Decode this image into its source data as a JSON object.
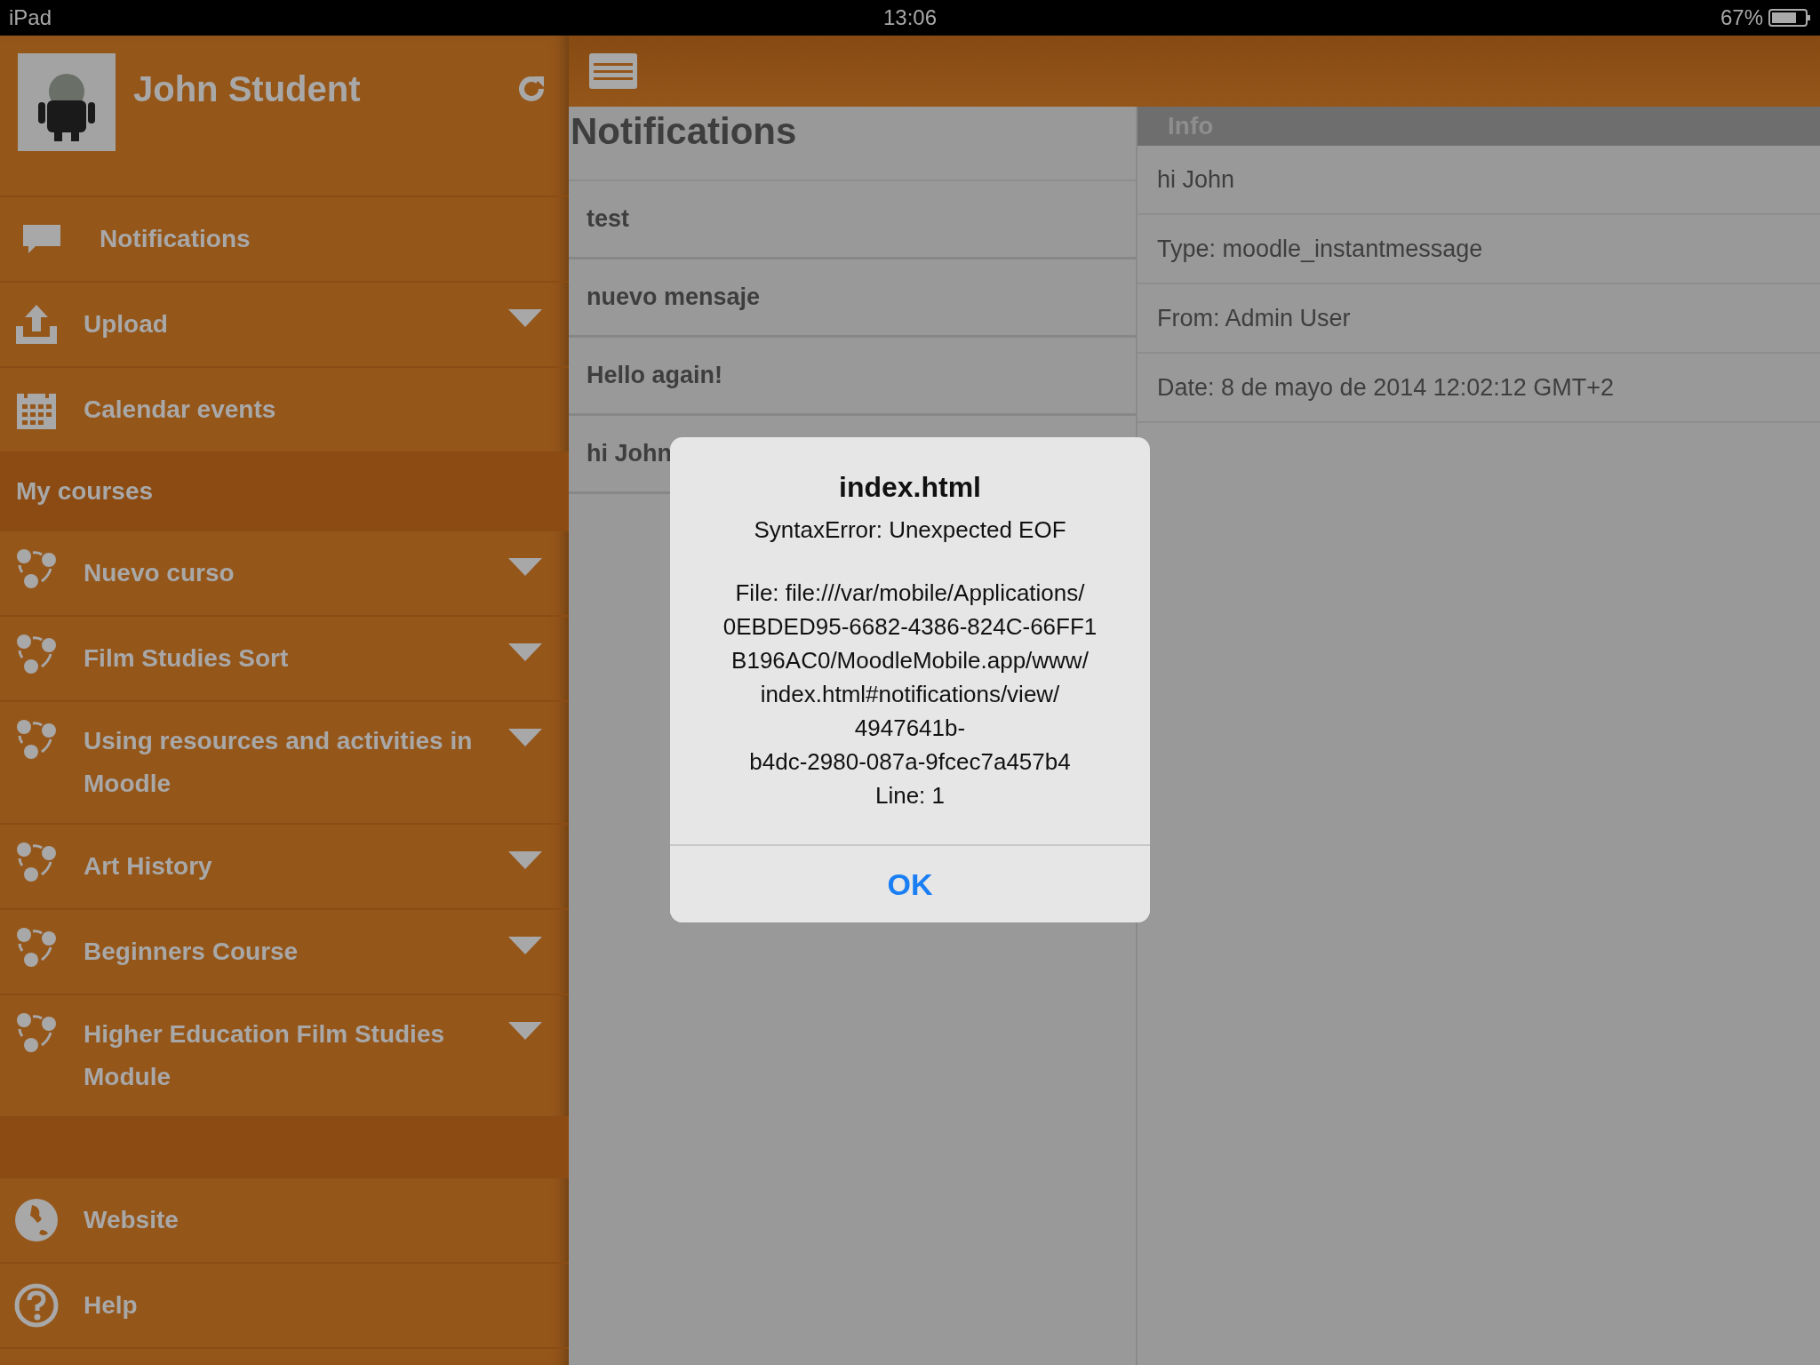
{
  "status_bar": {
    "device": "iPad",
    "time": "13:06",
    "battery": "67%"
  },
  "sidebar": {
    "user_name": "John Student",
    "items": [
      {
        "kind": "message",
        "label": "Notifications",
        "expandable": false
      },
      {
        "kind": "upload",
        "label": "Upload",
        "expandable": true
      },
      {
        "kind": "calendar",
        "label": "Calendar events",
        "expandable": false
      },
      {
        "kind": "section",
        "label": "My courses"
      },
      {
        "kind": "course",
        "label": "Nuevo curso",
        "expandable": true
      },
      {
        "kind": "course",
        "label": "Film Studies Sort",
        "expandable": true
      },
      {
        "kind": "course",
        "label": "Using resources and activities in Moodle",
        "expandable": true
      },
      {
        "kind": "course",
        "label": "Art History",
        "expandable": true
      },
      {
        "kind": "course",
        "label": "Beginners Course",
        "expandable": true
      },
      {
        "kind": "course",
        "label": "Higher Education Film Studies Module",
        "expandable": true
      },
      {
        "kind": "spacer"
      },
      {
        "kind": "website",
        "label": "Website",
        "expandable": false
      },
      {
        "kind": "help",
        "label": "Help",
        "expandable": false
      }
    ]
  },
  "notifications": {
    "title": "Notifications",
    "items": [
      {
        "label": "test"
      },
      {
        "label": "nuevo mensaje"
      },
      {
        "label": "Hello again!"
      },
      {
        "label": "hi John"
      }
    ]
  },
  "info": {
    "title": "Info",
    "rows": [
      "hi John",
      "Type: moodle_instantmessage",
      "From: Admin User",
      "Date: 8 de mayo de 2014 12:02:12 GMT+2"
    ]
  },
  "alert": {
    "title": "index.html",
    "message": "SyntaxError: Unexpected EOF",
    "details": [
      "File: file:///var/mobile/Applications/",
      "0EBDED95-6682-4386-824C-66FF1",
      "B196AC0/MoodleMobile.app/www/",
      "index.html#notifications/view/",
      "4947641b-",
      "b4dc-2980-087a-9fcec7a457b4",
      "Line: 1"
    ],
    "button": "OK"
  }
}
